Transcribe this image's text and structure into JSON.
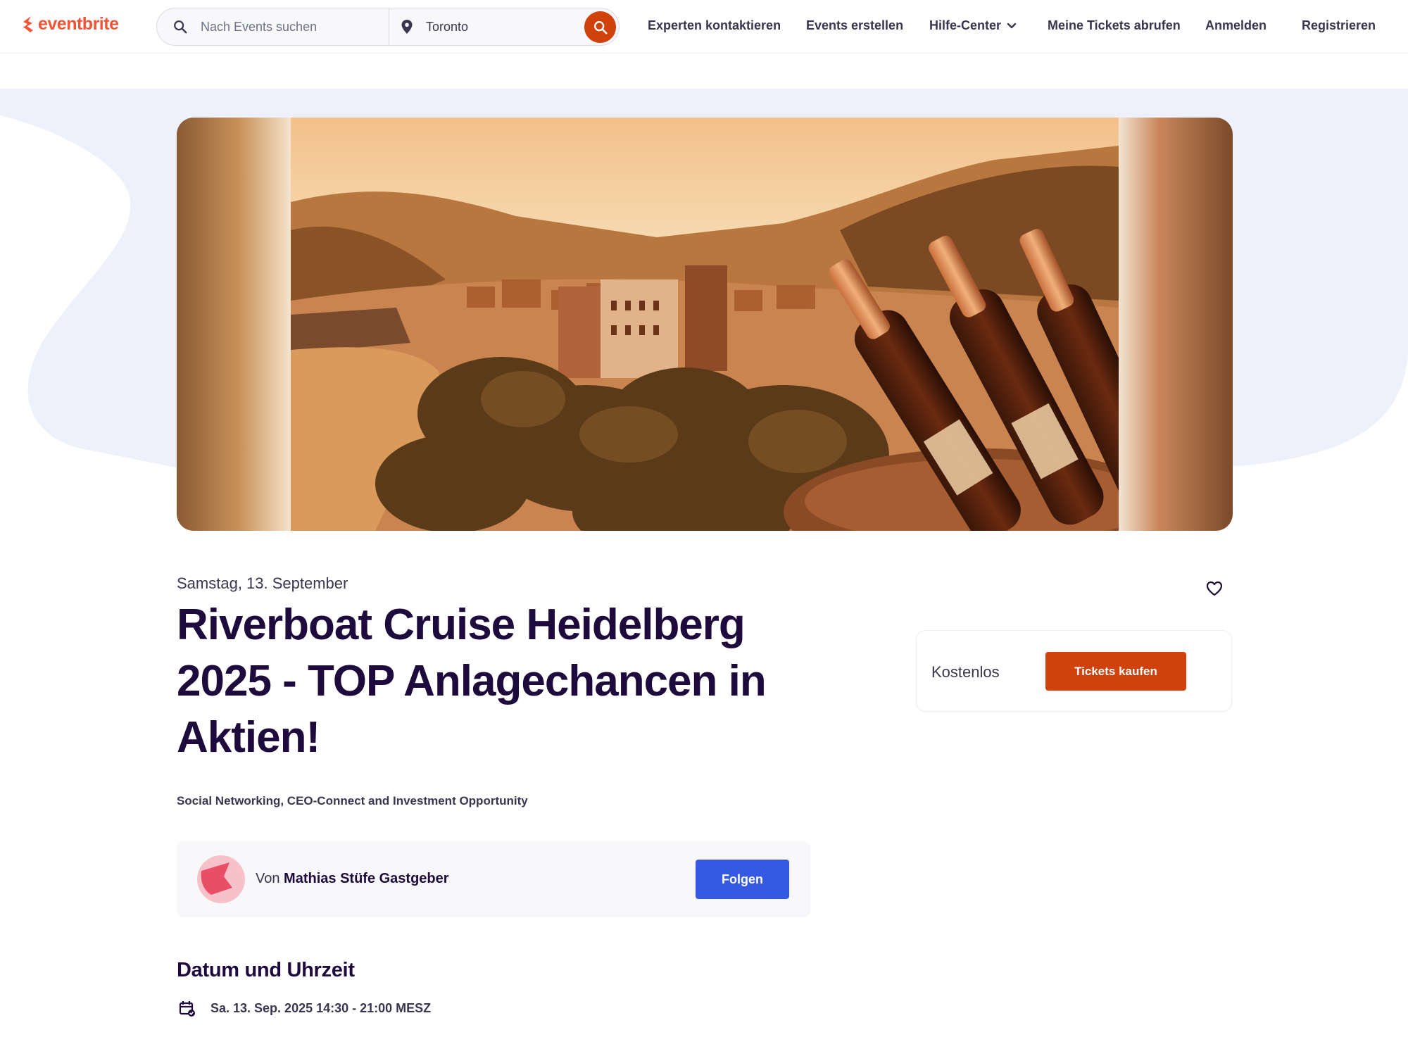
{
  "header": {
    "logo_text": "eventbrite",
    "search": {
      "placeholder": "Nach Events suchen",
      "location": "Toronto"
    },
    "nav": {
      "contact_experts": "Experten kontaktieren",
      "create_events": "Events erstellen",
      "help_center": "Hilfe-Center",
      "my_tickets": "Meine Tickets abrufen",
      "login": "Anmelden",
      "register": "Registrieren"
    }
  },
  "event": {
    "date_short": "Samstag, 13. September",
    "title": "Riverboat Cruise Heidelberg 2025 - TOP Anlagechancen in Aktien!",
    "summary": "Social Networking, CEO-Connect and Investment Opportunity"
  },
  "organizer": {
    "prefix": "Von",
    "name": "Mathias Stüfe Gastgeber",
    "follow_label": "Folgen"
  },
  "ticket": {
    "price_label": "Kostenlos",
    "buy_label": "Tickets kaufen"
  },
  "date_section": {
    "heading": "Datum und Uhrzeit",
    "datetime": "Sa. 13. Sep. 2025 14:30 - 21:00 MESZ"
  },
  "colors": {
    "brand": "#f05537",
    "primary_action": "#d1410c",
    "follow_blue": "#3659e3",
    "title_text": "#1e0a3c",
    "hero_wave": "#eef1fc"
  },
  "icons": [
    "search-icon",
    "location-pin-icon",
    "search-submit-icon",
    "chevron-down-icon",
    "heart-icon",
    "calendar-check-icon"
  ]
}
